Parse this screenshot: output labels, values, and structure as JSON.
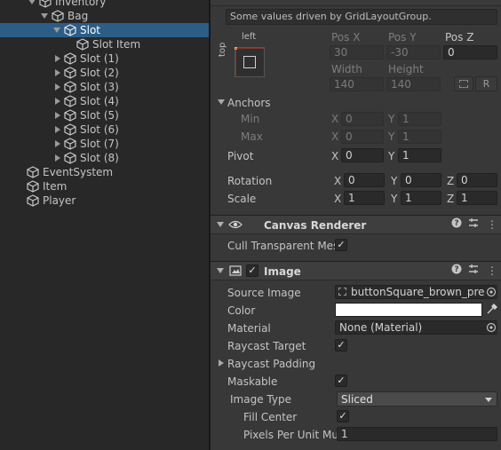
{
  "hierarchy": {
    "items": [
      {
        "label": "Inventory"
      },
      {
        "label": "Bag"
      },
      {
        "label": "Slot"
      },
      {
        "label": "Slot Item"
      },
      {
        "label": "Slot (1)"
      },
      {
        "label": "Slot (2)"
      },
      {
        "label": "Slot (3)"
      },
      {
        "label": "Slot (4)"
      },
      {
        "label": "Slot (5)"
      },
      {
        "label": "Slot (6)"
      },
      {
        "label": "Slot (7)"
      },
      {
        "label": "Slot (8)"
      },
      {
        "label": "EventSystem"
      },
      {
        "label": "Item"
      },
      {
        "label": "Player"
      }
    ]
  },
  "rect_transform": {
    "driven_notice": "Some values driven by GridLayoutGroup.",
    "anchor_h": "left",
    "anchor_v": "top",
    "pos_x_label": "Pos X",
    "pos_y_label": "Pos Y",
    "pos_z_label": "Pos Z",
    "pos_x": "30",
    "pos_y": "-30",
    "pos_z": "0",
    "width_label": "Width",
    "height_label": "Height",
    "width": "140",
    "height": "140",
    "raw_button": "R",
    "anchors_label": "Anchors",
    "min_label": "Min",
    "max_label": "Max",
    "min_x": "0",
    "min_y": "1",
    "max_x": "0",
    "max_y": "1",
    "pivot_label": "Pivot",
    "pivot_x": "0",
    "pivot_y": "1",
    "rotation_label": "Rotation",
    "rot_x": "0",
    "rot_y": "0",
    "rot_z": "0",
    "scale_label": "Scale",
    "scale_x": "1",
    "scale_y": "1",
    "scale_z": "1",
    "axis_x": "X",
    "axis_y": "Y",
    "axis_z": "Z"
  },
  "canvas_renderer": {
    "title": "Canvas Renderer",
    "cull_label": "Cull Transparent Mes",
    "cull_checked": true
  },
  "image": {
    "title": "Image",
    "enabled": true,
    "source_image_label": "Source Image",
    "source_image_value": "buttonSquare_brown_press",
    "color_label": "Color",
    "color_value": "#ffffff",
    "material_label": "Material",
    "material_value": "None (Material)",
    "raycast_target_label": "Raycast Target",
    "raycast_target_checked": true,
    "raycast_padding_label": "Raycast Padding",
    "maskable_label": "Maskable",
    "maskable_checked": true,
    "image_type_label": "Image Type",
    "image_type_value": "Sliced",
    "fill_center_label": "Fill Center",
    "fill_center_checked": true,
    "ppu_label": "Pixels Per Unit Mul",
    "ppu_value": "1"
  },
  "icons": {
    "checkmark": "✓",
    "help": "?",
    "settings": "⇅",
    "menu": "⋮",
    "target": "◉",
    "eyedropper": "✎",
    "dropdown": "▾"
  }
}
